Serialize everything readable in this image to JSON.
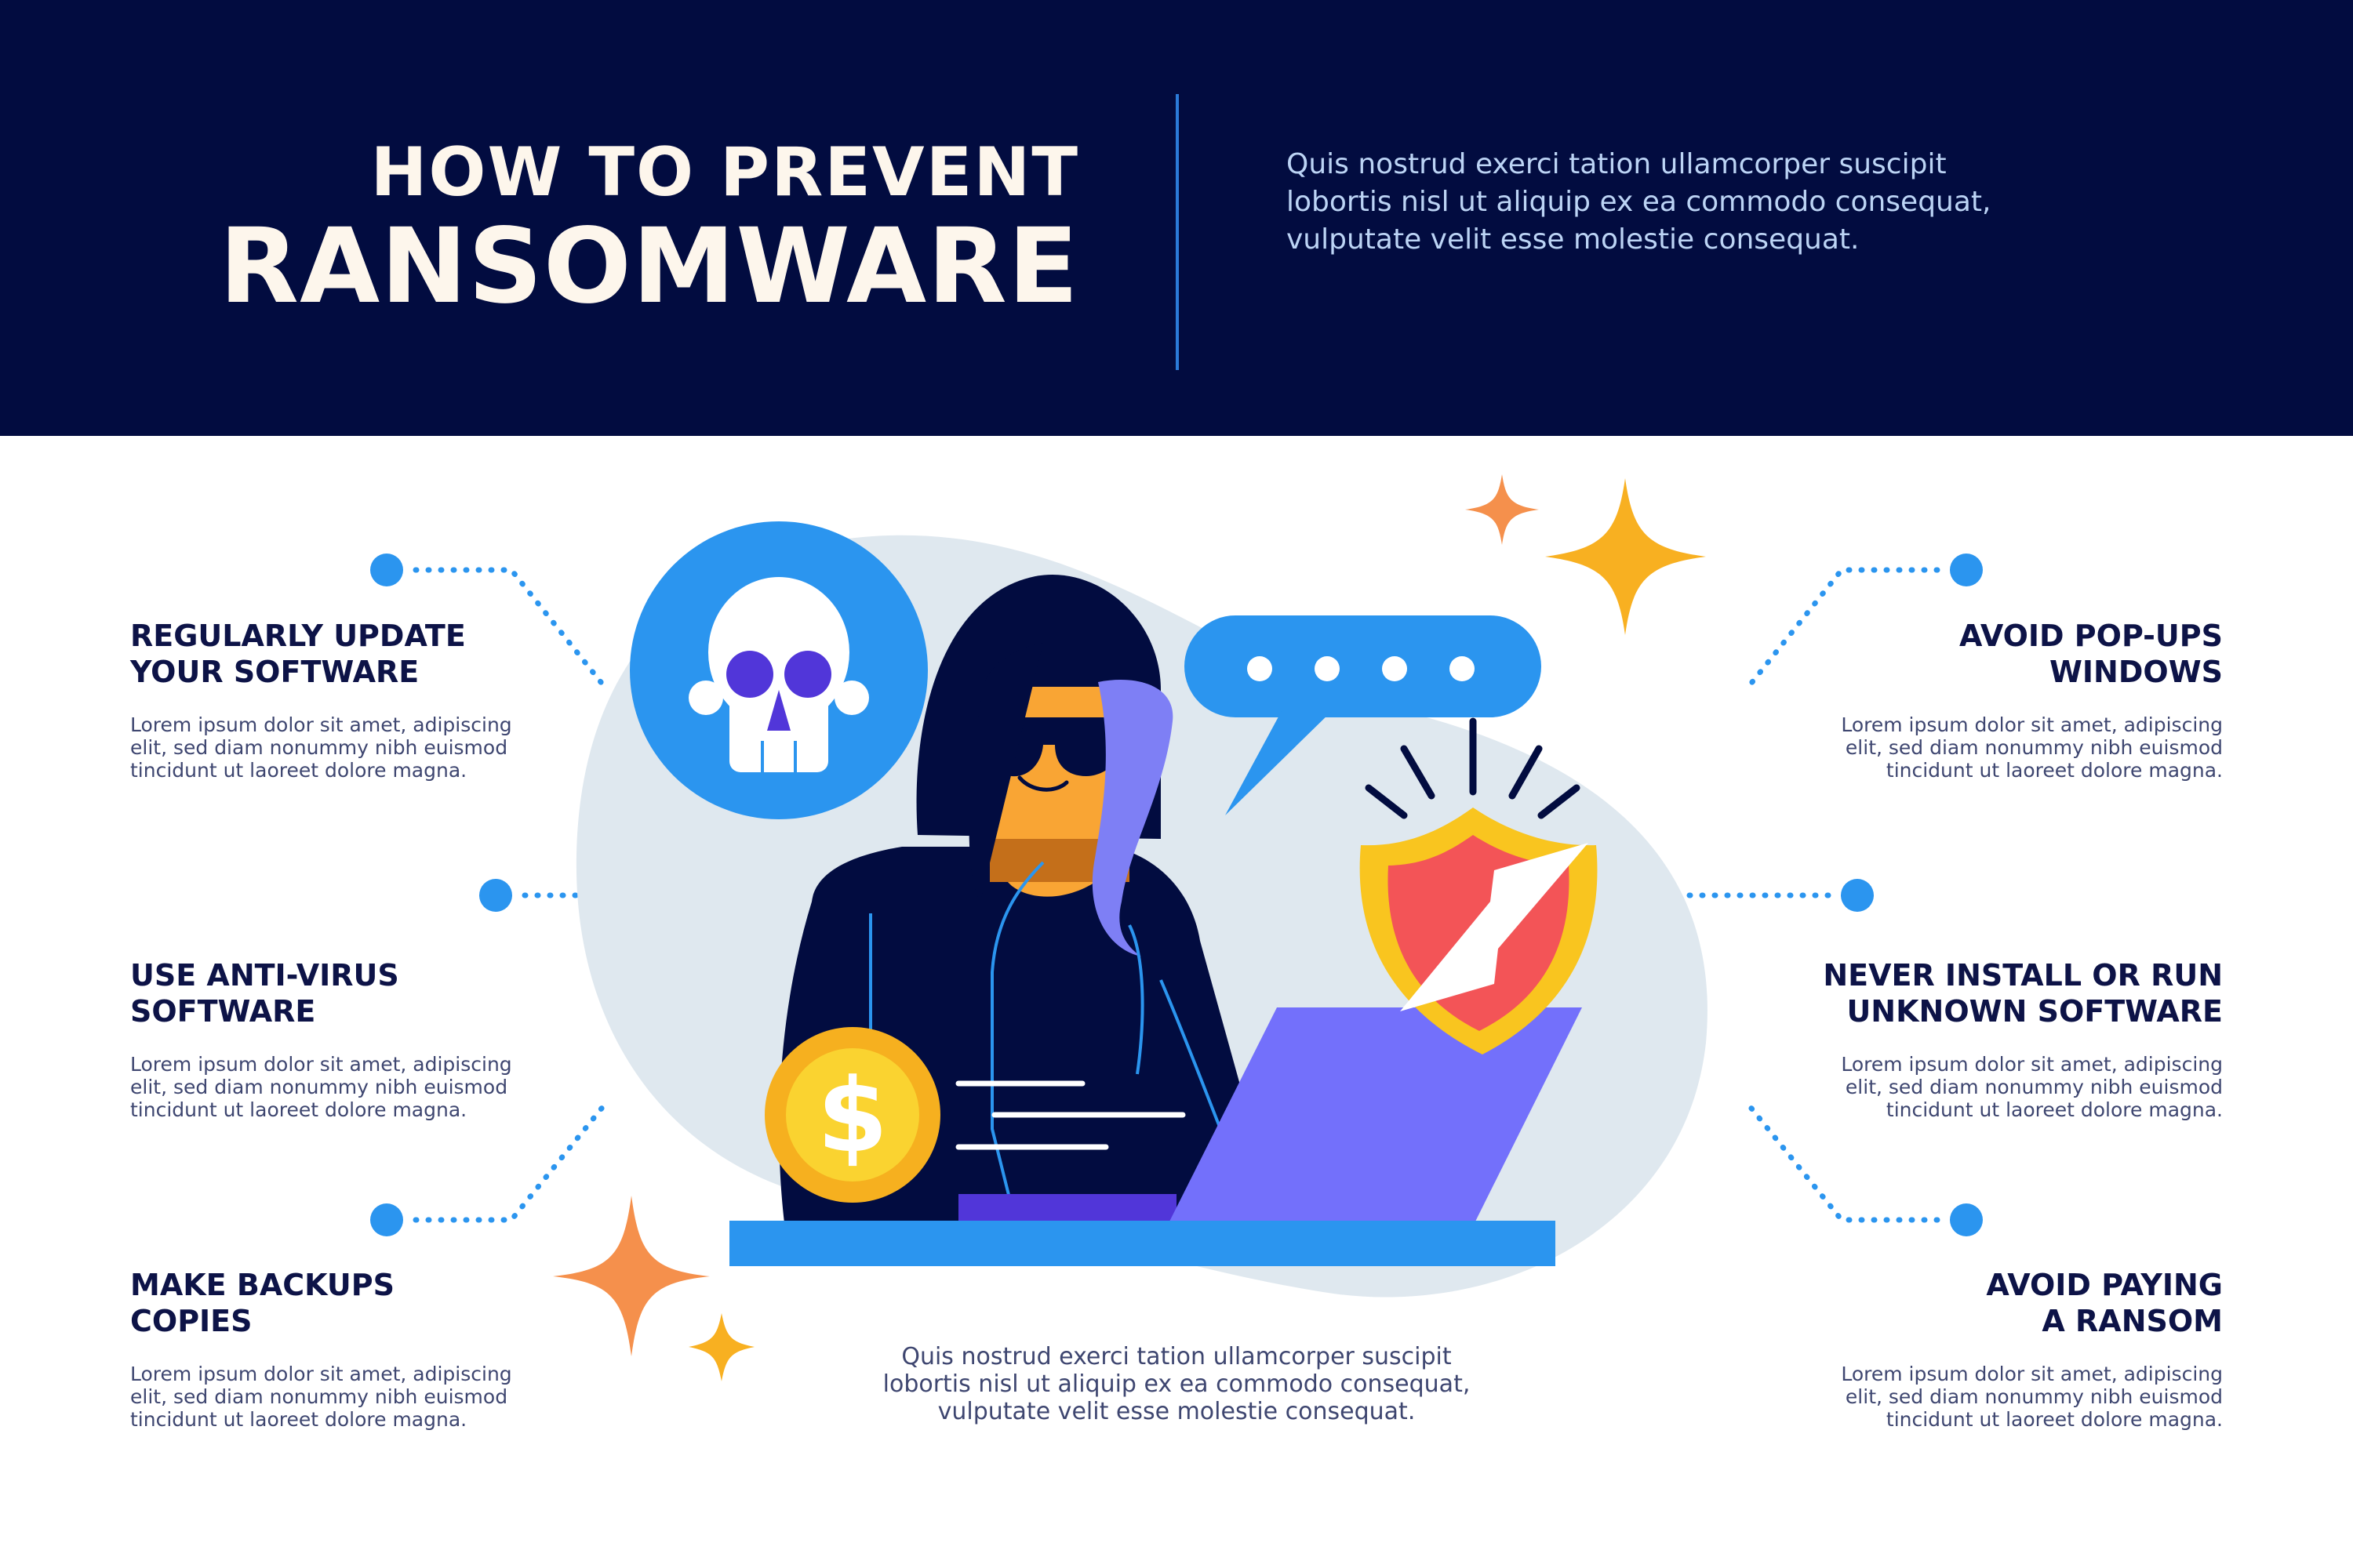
{
  "header": {
    "title_line1": "HOW TO PREVENT",
    "title_line2": "RANSOMWARE",
    "description": "Quis nostrud exerci tation ullamcorper suscipit lobortis nisl ut aliquip ex ea commodo consequat, vulputate velit esse molestie consequat."
  },
  "tips": {
    "update": {
      "title": "REGULARLY UPDATE\nYOUR SOFTWARE",
      "body": "Lorem ipsum dolor sit amet, adipiscing\nelit, sed diam nonummy nibh euismod\ntincidunt ut laoreet dolore magna."
    },
    "antivirus": {
      "title": "USE ANTI-VIRUS\nSOFTWARE",
      "body": "Lorem ipsum dolor sit amet, adipiscing\nelit, sed diam nonummy nibh euismod\ntincidunt ut laoreet dolore magna."
    },
    "backups": {
      "title": "MAKE BACKUPS\nCOPIES",
      "body": "Lorem ipsum dolor sit amet, adipiscing\nelit, sed diam nonummy nibh euismod\ntincidunt ut laoreet dolore magna."
    },
    "popups": {
      "title": "AVOID POP-UPS\nWINDOWS",
      "body": "Lorem ipsum dolor sit amet, adipiscing\nelit, sed diam nonummy nibh euismod\ntincidunt ut laoreet dolore magna."
    },
    "unknown": {
      "title": "NEVER INSTALL OR RUN\nUNKNOWN SOFTWARE",
      "body": "Lorem ipsum dolor sit amet, adipiscing\nelit, sed diam nonummy nibh euismod\ntincidunt ut laoreet dolore magna."
    },
    "ransom": {
      "title": "AVOID PAYING\nA RANSOM",
      "body": "Lorem ipsum dolor sit amet, adipiscing\nelit, sed diam nonummy nibh euismod\ntincidunt ut laoreet dolore magna."
    }
  },
  "footer": {
    "description": "Quis nostrud exerci tation ullamcorper suscipit lobortis nisl ut aliquip ex ea commodo consequat, vulputate velit esse molestie consequat."
  },
  "colors": {
    "navy": "#020c40",
    "accent_blue": "#2b95ef",
    "orange_sparkle": "#f5904c",
    "yellow_sparkle": "#f8b021",
    "shield_red": "#f35457",
    "laptop_purple": "#7370fb"
  },
  "icons": {
    "skull": "skull-icon",
    "chat": "speech-bubble-icon",
    "shield": "broken-shield-icon",
    "coin": "dollar-coin-icon"
  }
}
